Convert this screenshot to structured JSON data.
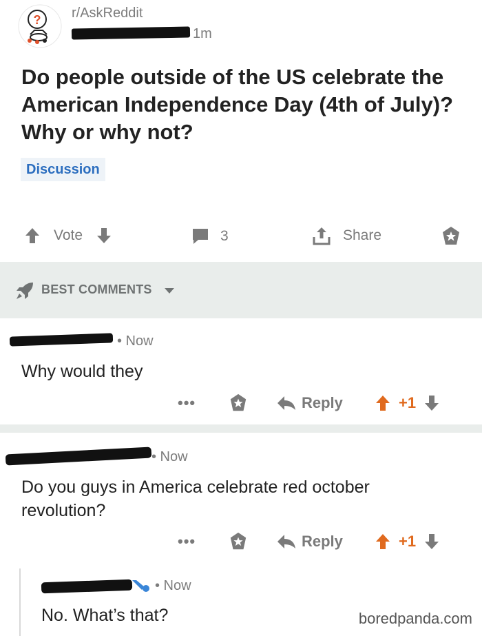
{
  "post": {
    "subreddit": "r/AskReddit",
    "time": "1m",
    "title": "Do people outside of the US celebrate the American Independence Day (4th of July)? Why or why not?",
    "flair": "Discussion"
  },
  "actions": {
    "vote_label": "Vote",
    "comment_count": "3",
    "share_label": "Share"
  },
  "comments_header": {
    "sort_label": "BEST COMMENTS"
  },
  "comments": [
    {
      "time": "• Now",
      "body": "Why would they",
      "reply_label": "Reply",
      "score": "+1",
      "more": "•••"
    },
    {
      "time": "• Now",
      "body": "Do you guys in America celebrate red october revolution?",
      "reply_label": "Reply",
      "score": "+1",
      "more": "•••"
    },
    {
      "time": "• Now",
      "body": "No. What’s that?"
    }
  ],
  "watermark": "boredpanda.com",
  "colors": {
    "accent": "#e06a1e",
    "flair": "#2c6ebf",
    "section_bg": "#e9edeb"
  }
}
